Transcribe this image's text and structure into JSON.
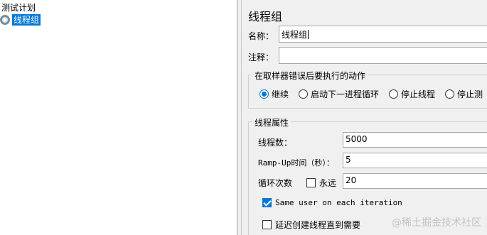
{
  "tree": {
    "root_label": "测试计划",
    "selected_node_label": "线程组"
  },
  "panel": {
    "title": "线程组",
    "name_label": "名称：",
    "name_value": "线程组",
    "comment_label": "注释：",
    "comment_value": "",
    "error_action": {
      "title": "在取样器错误后要执行的动作",
      "options": [
        "继续",
        "启动下一进程循环",
        "停止线程",
        "停止测"
      ],
      "selected_index": 0
    },
    "thread_props": {
      "title": "线程属性",
      "threads_label": "线程数：",
      "threads_value": "5000",
      "rampup_label": "Ramp-Up时间（秒）：",
      "rampup_value": "5",
      "loop_label": "循环次数",
      "forever_label": "永远",
      "forever_checked": false,
      "loop_value": "20",
      "same_user_label": "Same user on each iteration",
      "same_user_checked": true,
      "delay_label": "延迟创建线程直到需要",
      "delay_checked": false
    }
  },
  "watermark": "@稀土掘金技术社区",
  "colors": {
    "accent": "#0078d7"
  }
}
